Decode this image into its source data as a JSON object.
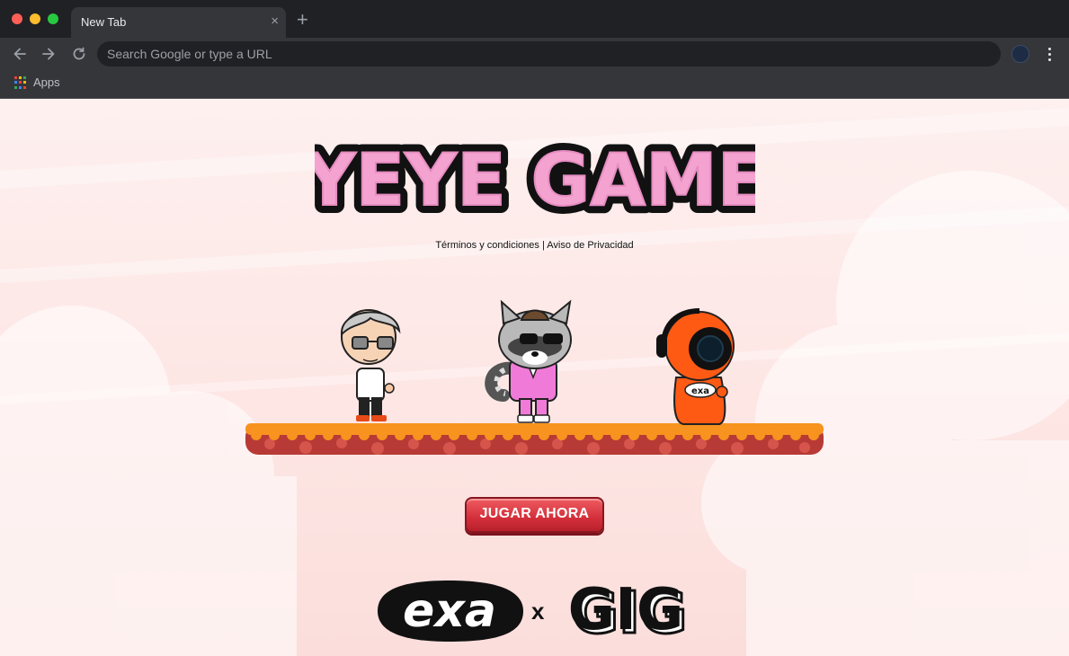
{
  "browser": {
    "tab_title": "New Tab",
    "tab_close": "×",
    "new_tab": "+",
    "omnibox_placeholder": "Search Google or type a URL",
    "bookmarks": {
      "apps_label": "Apps"
    }
  },
  "page": {
    "title": "YEYE GAME",
    "links": {
      "terms": "Términos y condiciones",
      "separator": " | ",
      "privacy": "Aviso de Privacidad"
    },
    "cta_label": "JUGAR AHORA",
    "logos": {
      "exa": "exa",
      "x": "x",
      "gig": "GIG"
    }
  },
  "colors": {
    "accent_red": "#d32f3a",
    "title_pink": "#f4a3d1",
    "platform_orange": "#f7931e",
    "platform_red": "#b83a36"
  },
  "icons": [
    "back-icon",
    "forward-icon",
    "reload-icon",
    "extension-icon",
    "menu-icon",
    "apps-icon"
  ]
}
